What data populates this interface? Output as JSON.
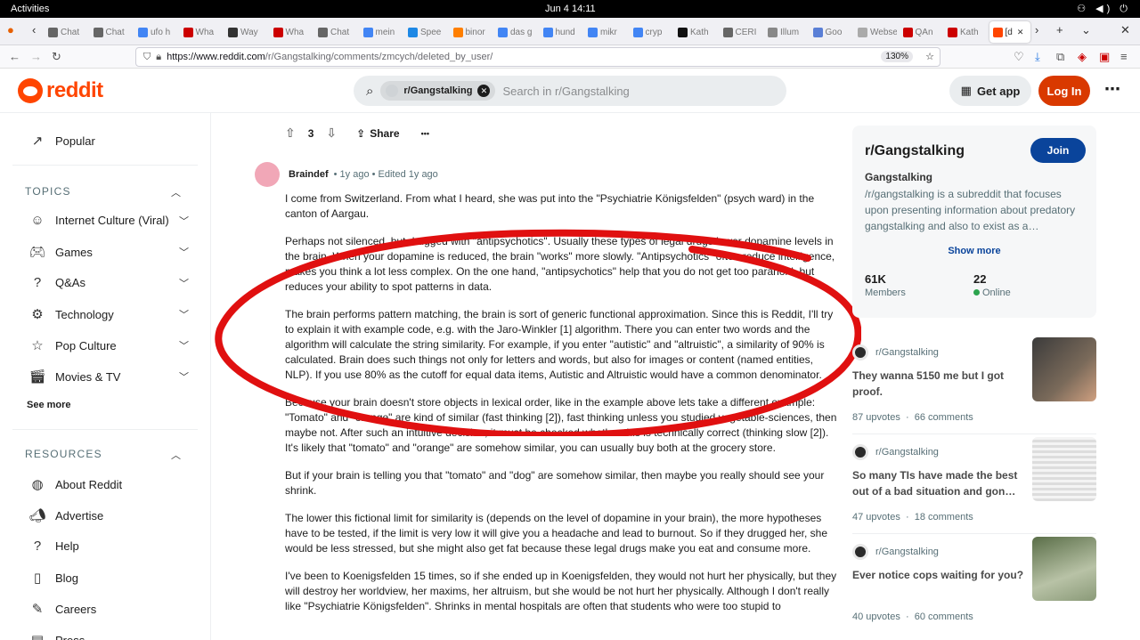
{
  "gnome": {
    "activities": "Activities",
    "clock": "Jun 4  14:11"
  },
  "tabs": [
    {
      "label": "Chat"
    },
    {
      "label": "Chat"
    },
    {
      "label": "ufo h"
    },
    {
      "label": "Wha"
    },
    {
      "label": "Way"
    },
    {
      "label": "Wha"
    },
    {
      "label": "Chat"
    },
    {
      "label": "mein"
    },
    {
      "label": "Spee"
    },
    {
      "label": "binor"
    },
    {
      "label": "das g"
    },
    {
      "label": "hund"
    },
    {
      "label": "mikr"
    },
    {
      "label": "cryp"
    },
    {
      "label": "Kath"
    },
    {
      "label": "CERI"
    },
    {
      "label": "Illum"
    },
    {
      "label": "Goo"
    },
    {
      "label": "Webseit"
    },
    {
      "label": "QAn"
    },
    {
      "label": "Kath"
    },
    {
      "label": "[d"
    }
  ],
  "url": {
    "domain": "https://www.reddit.com",
    "path": "/r/Gangstalking/comments/zmcych/deleted_by_user/",
    "zoom": "130%"
  },
  "header": {
    "logo": "reddit",
    "search_chip": "r/Gangstalking",
    "search_placeholder": "Search in r/Gangstalking",
    "get_app": "Get app",
    "login": "Log In"
  },
  "sidebar": {
    "popular": "Popular",
    "topics_title": "TOPICS",
    "topics": [
      "Internet Culture (Viral)",
      "Games",
      "Q&As",
      "Technology",
      "Pop Culture",
      "Movies & TV"
    ],
    "see_more": "See more",
    "resources_title": "RESOURCES",
    "resources": [
      "About Reddit",
      "Advertise",
      "Help",
      "Blog",
      "Careers",
      "Press"
    ]
  },
  "post_actions": {
    "votes": "3",
    "share": "Share",
    "more": "•••"
  },
  "comment": {
    "author": "Braindef",
    "time": "• 1y ago • Edited 1y ago",
    "paragraphs": [
      "I come from Switzerland. From what I heard, she was put into the \"Psychiatrie Königsfelden\" (psych ward) in the canton of Aargau.",
      "Perhaps not silenced, but drugged with \"antipsychotics\". Usually these types of legal drugs lower dopamine levels in the brain. When your dopamine is reduced, the brain \"works\" more slowly. \"Antipsychotics\" often reduce intelligence, makes you think a lot less complex. On the one hand, \"antipsychotics\" help that you do not get too paranoid, but reduces your ability to spot patterns in data.",
      "The brain performs pattern matching, the brain is sort of generic functional approximation. Since this is Reddit, I'll try to explain it with example code, e.g. with the Jaro-Winkler [1] algorithm. There you can enter two words and the algorithm will calculate the string similarity. For example, if you enter \"autistic\" and \"altruistic\", a similarity of 90% is calculated. Brain does such things not only for letters and words, but also for images or content (named entities, NLP). If you use 80% as the cutoff for equal data items, Autistic and Altruistic would have a common denominator.",
      "Because your brain doesn't store objects in lexical order, like in the example above lets take a different example: \"Tomato\" and \"orange\" are kind of similar (fast thinking [2]), fast thinking unless you studied vegetable-sciences, then maybe not. After such an intuitive decision, it must be checked whether this is technically correct (thinking slow [2]). It's likely that \"tomato\" and \"orange\" are somehow similar, you can usually buy both at the grocery store.",
      "But if your brain is telling you that \"tomato\" and \"dog\" are somehow similar, then maybe you really should see your shrink.",
      "The lower this fictional limit for similarity is (depends on the level of dopamine in your brain), the more hypotheses have to be tested, if the limit is very low it will give you a headache and lead to burnout. So if they drugged her, she would be less stressed, but she might also get fat because these legal drugs make you eat and consume more.",
      "I've been to Koenigsfelden 15 times, so if she ended up in Koenigsfelden, they would not hurt her physically, but they will destroy her worldview, her maxims, her altruism, but she would be not hurt her physically. Although I don't really like \"Psychiatrie Königsfelden\". Shrinks in mental hospitals are often that students who were too stupid to"
    ]
  },
  "community": {
    "name": "r/Gangstalking",
    "join": "Join",
    "subtitle": "Gangstalking",
    "description": "/r/gangstalking is a subreddit that focuses upon presenting information about predatory gangstalking and also to exist as a…",
    "show_more": "Show more",
    "members_value": "61K",
    "members_label": "Members",
    "online_value": "22",
    "online_label": "Online"
  },
  "related": [
    {
      "sub": "r/Gangstalking",
      "title": "They wanna 5150 me but I got proof.",
      "upvotes": "87 upvotes",
      "comments": "66 comments"
    },
    {
      "sub": "r/Gangstalking",
      "title": "So many TIs have made the best out of a bad situation and gon…",
      "upvotes": "47 upvotes",
      "comments": "18 comments"
    },
    {
      "sub": "r/Gangstalking",
      "title": "Ever notice cops waiting for you?",
      "upvotes": "40 upvotes",
      "comments": "60 comments"
    }
  ],
  "colors": {
    "reddit_orange": "#ff4500",
    "login_bg": "#d93900",
    "join_bg": "#0a449b",
    "annotation_red": "#e01010"
  }
}
